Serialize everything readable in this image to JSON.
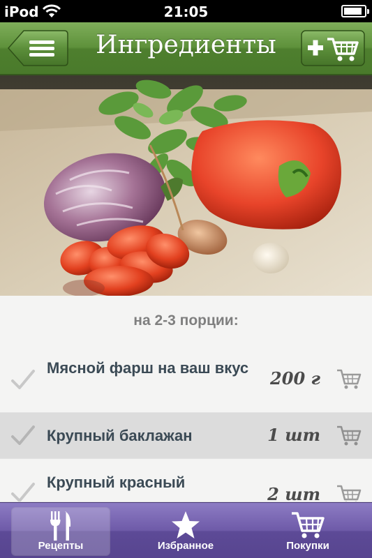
{
  "status_bar": {
    "carrier": "iPod",
    "time": "21:05",
    "battery_level": 0.9
  },
  "nav_bar": {
    "title": "Ингредиенты",
    "back_icon": "menu-list-icon",
    "add_to_cart_icon": "add-cart-icon"
  },
  "colors": {
    "nav_green": "#5e913b",
    "tab_purple": "#6e5aa8",
    "row_highlight": "#dcdcdc",
    "tomato_red": "#e8442a"
  },
  "servings_label": "на 2-3 порции:",
  "ingredients": [
    {
      "name": "Мясной фарш на ваш вкус",
      "quantity": "200 г",
      "highlighted": false
    },
    {
      "name": "Крупный баклажан",
      "quantity": "1 шт",
      "highlighted": true
    },
    {
      "name": "Крупный красный",
      "quantity": "2 шт",
      "highlighted": false
    }
  ],
  "tab_bar": {
    "tabs": [
      {
        "label": "Рецепты",
        "icon": "fork-knife-icon",
        "active": true
      },
      {
        "label": "Избранное",
        "icon": "star-icon",
        "active": false
      },
      {
        "label": "Покупки",
        "icon": "shopping-cart-icon",
        "active": false
      }
    ]
  }
}
